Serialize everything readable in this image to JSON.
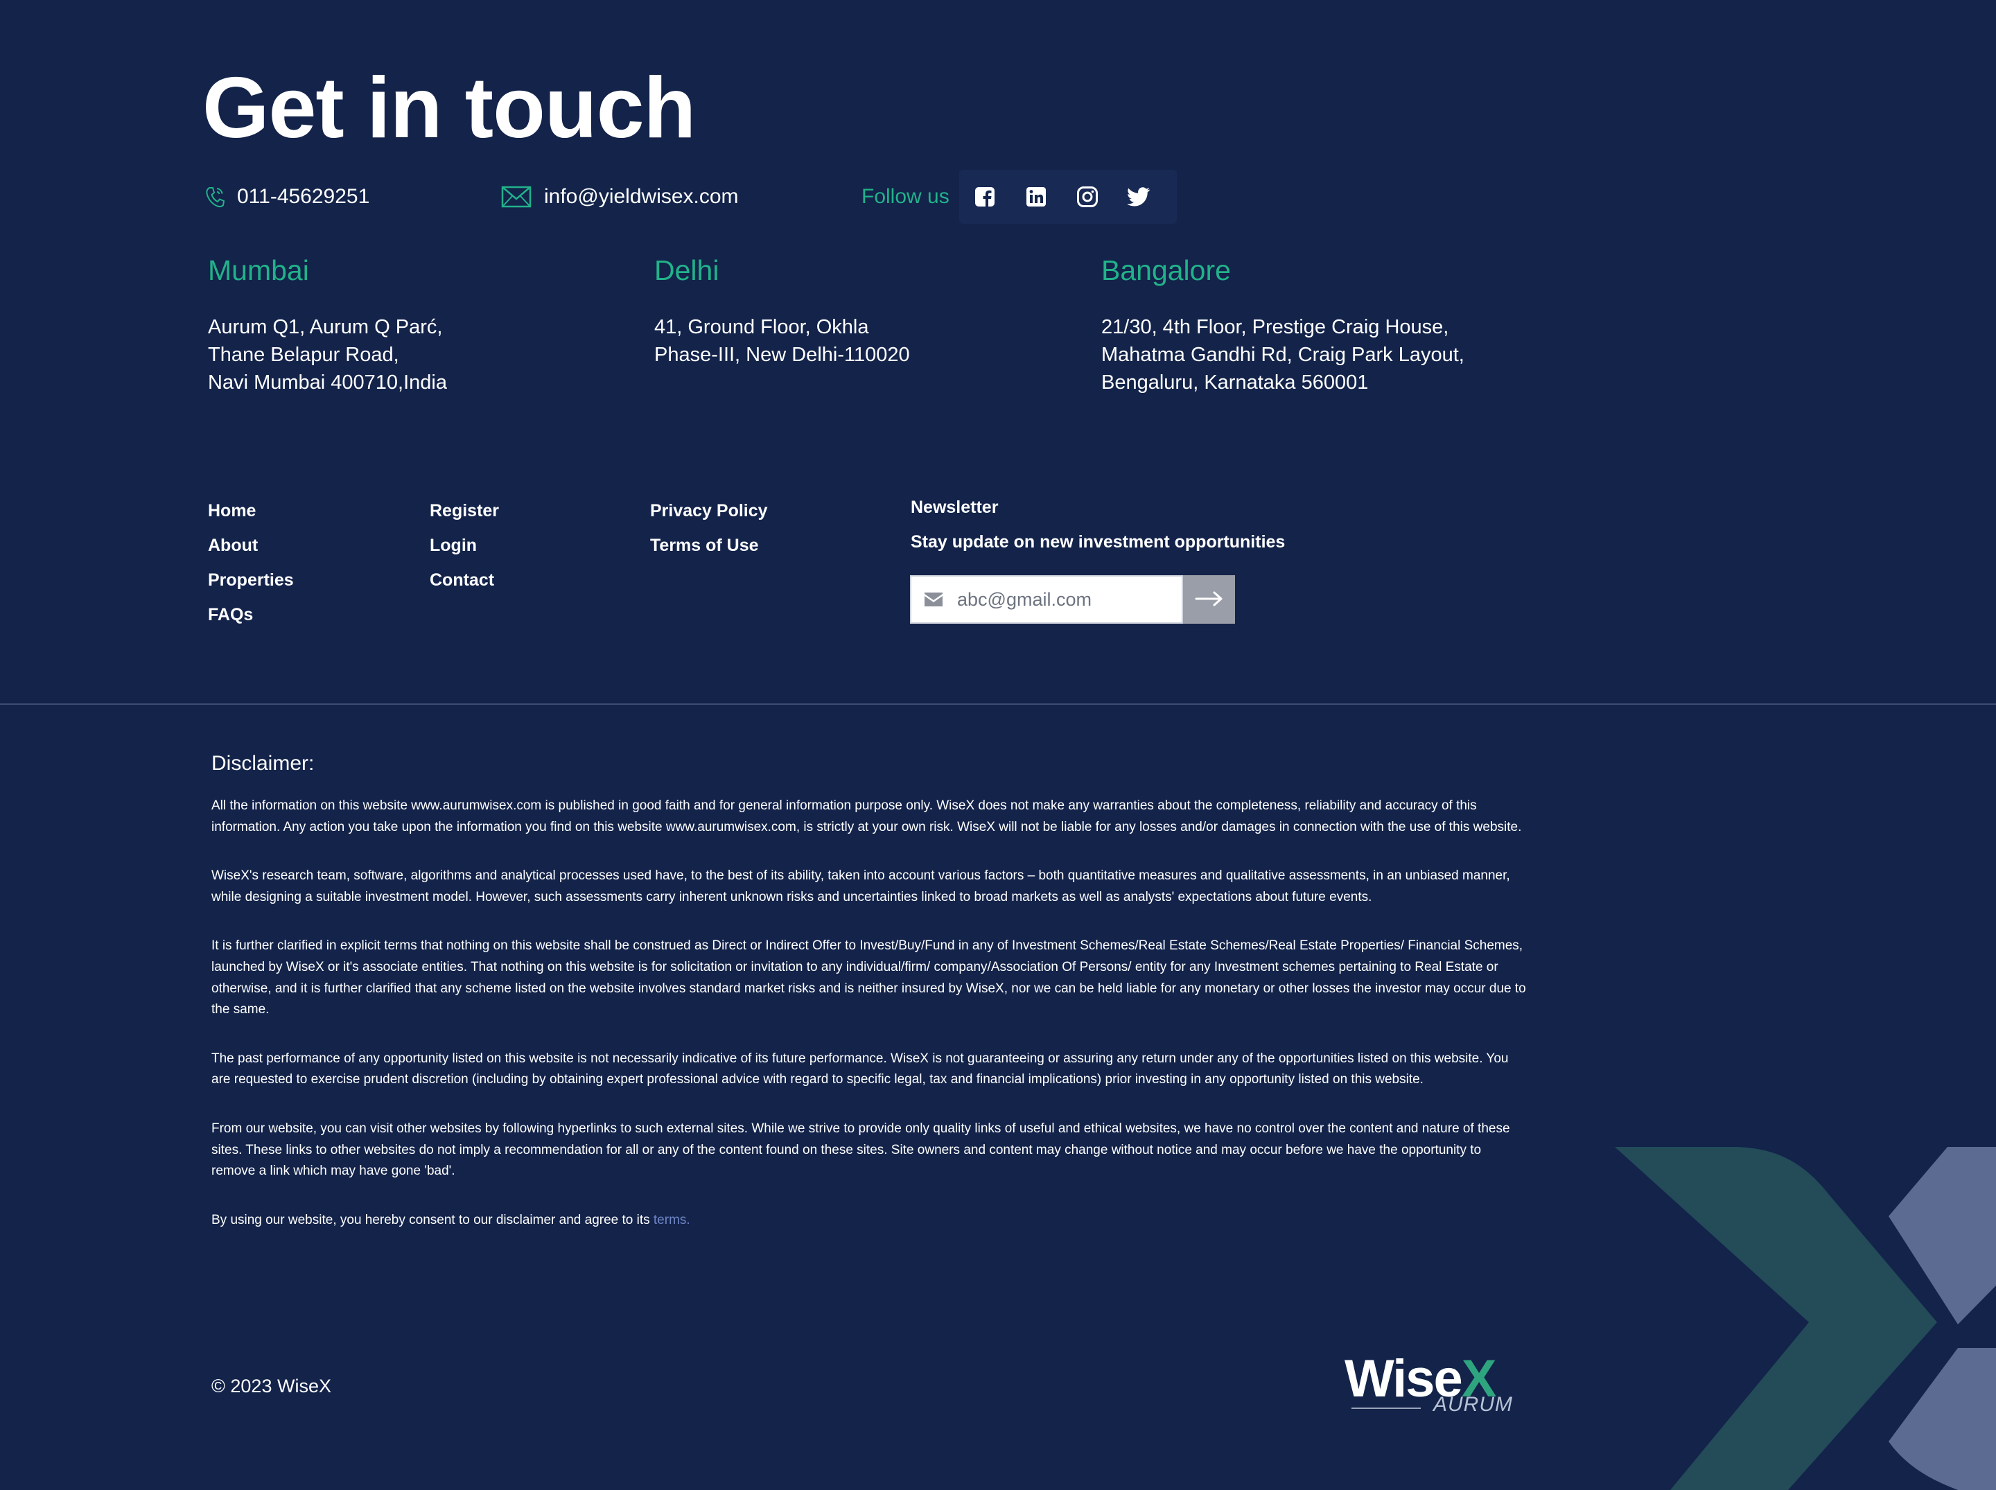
{
  "header": {
    "title": "Get in touch",
    "phone": "011-45629251",
    "email": "info@yieldwisex.com",
    "follow_label": "Follow us",
    "social": [
      {
        "name": "facebook-icon"
      },
      {
        "name": "linkedin-icon"
      },
      {
        "name": "instagram-icon"
      },
      {
        "name": "twitter-icon"
      }
    ]
  },
  "offices": [
    {
      "city": "Mumbai",
      "lines": [
        "Aurum Q1, Aurum Q Parć,",
        "Thane Belapur Road,",
        "Navi Mumbai 400710,India"
      ]
    },
    {
      "city": "Delhi",
      "lines": [
        "41, Ground Floor, Okhla",
        "Phase-III, New Delhi-110020"
      ]
    },
    {
      "city": "Bangalore",
      "lines": [
        "21/30, 4th Floor, Prestige Craig House,",
        "Mahatma Gandhi Rd, Craig Park Layout,",
        "Bengaluru, Karnataka 560001"
      ]
    }
  ],
  "links": {
    "col1": [
      "Home",
      "About",
      "Properties",
      "FAQs"
    ],
    "col2": [
      "Register",
      "Login",
      "Contact"
    ],
    "col3": [
      "Privacy Policy",
      "Terms of Use"
    ]
  },
  "newsletter": {
    "title": "Newsletter",
    "subtitle": "Stay update on new investment opportunities",
    "placeholder": "abc@gmail.com"
  },
  "disclaimer": {
    "title": "Disclaimer:",
    "paragraphs": [
      "All the information on this website www.aurumwisex.com is published in good faith and for general information purpose only. WiseX does not make any warranties about the completeness, reliability and accuracy of this information. Any action you take upon the information you find on this website www.aurumwisex.com, is strictly at your own risk. WiseX will not be liable for any losses and/or damages in connection with the use of this website.",
      "WiseX's research team, software, algorithms and analytical processes used have, to the best of its ability, taken into account various factors – both quantitative measures and qualitative assessments, in an unbiased manner, while designing a suitable investment model. However, such assessments carry inherent unknown risks and uncertainties linked to broad markets as well as analysts' expectations about future events.",
      "It is further clarified in explicit terms that nothing on this website shall be construed as Direct or Indirect Offer to Invest/Buy/Fund in any of Investment Schemes/Real Estate Schemes/Real Estate Properties/ Financial Schemes, launched by WiseX or it's associate entities. That nothing on this website is for solicitation or invitation to any individual/firm/ company/Association Of Persons/ entity for any Investment schemes pertaining to Real Estate or otherwise, and it is further clarified that any scheme listed on the website involves standard market risks and is neither insured by WiseX, nor we can be held liable for any monetary or other losses the investor may occur due to the same.",
      "The past performance of any opportunity listed on this website is not necessarily indicative of its future performance. WiseX is not guaranteeing or assuring any return under any of the opportunities listed on this website. You are requested to exercise prudent discretion (including by obtaining expert professional advice with regard to specific legal, tax and financial implications) prior investing in any opportunity listed on this website.",
      "From our website, you can visit other websites by following hyperlinks to such external sites. While we strive to provide only quality links of useful and ethical websites, we have no control over the content and nature of these sites. These links to other websites do not imply a recommendation for all or any of the content found on these sites. Site owners and content may change without notice and may occur before we have the opportunity to remove a link which may have gone 'bad'."
    ],
    "consent_text": "By using our website, you hereby consent to our disclaimer and agree to its ",
    "terms_link": "terms."
  },
  "footer": {
    "copyright": "© 2023 WiseX",
    "logo_main": "Wise",
    "logo_x": "X",
    "logo_sub": "AURUM"
  },
  "colors": {
    "background": "#13234a",
    "accent": "#22b28a",
    "link": "#6f86c6",
    "decor_teal": "#234b58",
    "decor_slate": "#5c6b91"
  }
}
